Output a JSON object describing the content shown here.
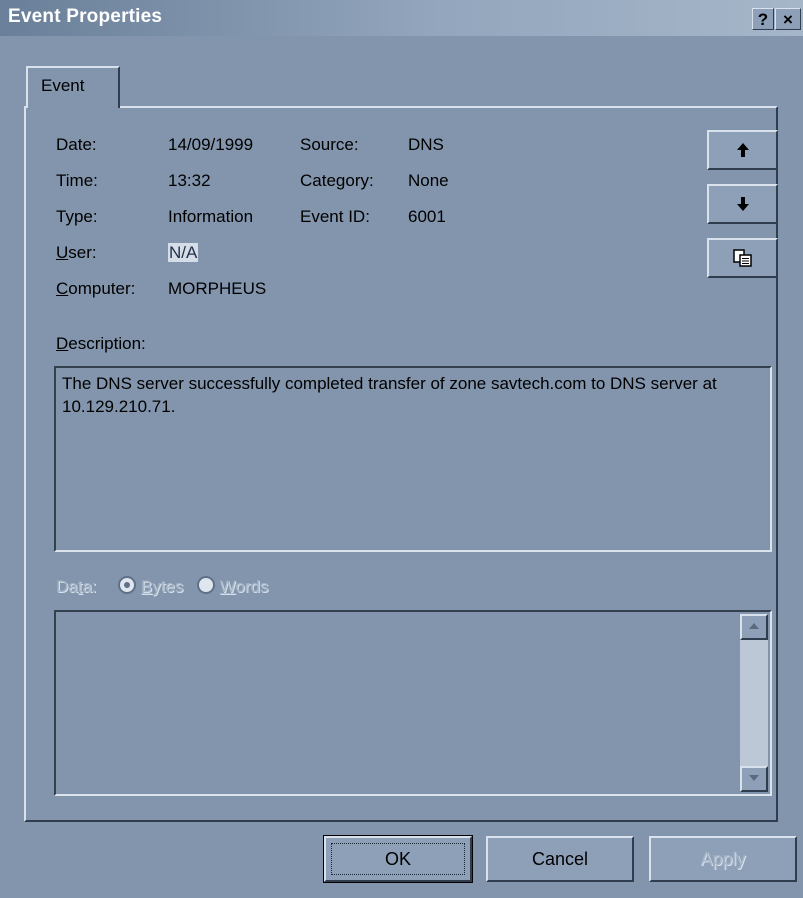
{
  "window": {
    "title": "Event Properties",
    "help_label": "?",
    "close_label": "×"
  },
  "tabs": [
    {
      "label": "Event"
    }
  ],
  "fields": {
    "date_label": "Date:",
    "date_value": "14/09/1999",
    "source_label": "Source:",
    "source_value": "DNS",
    "time_label": "Time:",
    "time_value": "13:32",
    "category_label": "Category:",
    "category_value": "None",
    "type_label": "Type:",
    "type_value": "Information",
    "eventid_label": "Event ID:",
    "eventid_value": "6001",
    "user_label_first": "U",
    "user_label_rest": "ser:",
    "user_value": "N/A",
    "computer_label_first": "C",
    "computer_label_rest": "omputer:",
    "computer_value": "MORPHEUS"
  },
  "description": {
    "label_first": "D",
    "label_rest": "escription:",
    "text": "The DNS server successfully completed transfer of zone savtech.com to DNS server at 10.129.210.71."
  },
  "data": {
    "label_pre": "Da",
    "label_u": "t",
    "label_post": "a:",
    "bytes_first": "B",
    "bytes_rest": "ytes",
    "words_first": "W",
    "words_rest": "ords",
    "selected": "Bytes"
  },
  "nav_buttons": {
    "up_icon": "arrow-up-icon",
    "down_icon": "arrow-down-icon",
    "copy_icon": "copy-icon"
  },
  "buttons": {
    "ok": "OK",
    "cancel": "Cancel",
    "apply": "Apply"
  }
}
